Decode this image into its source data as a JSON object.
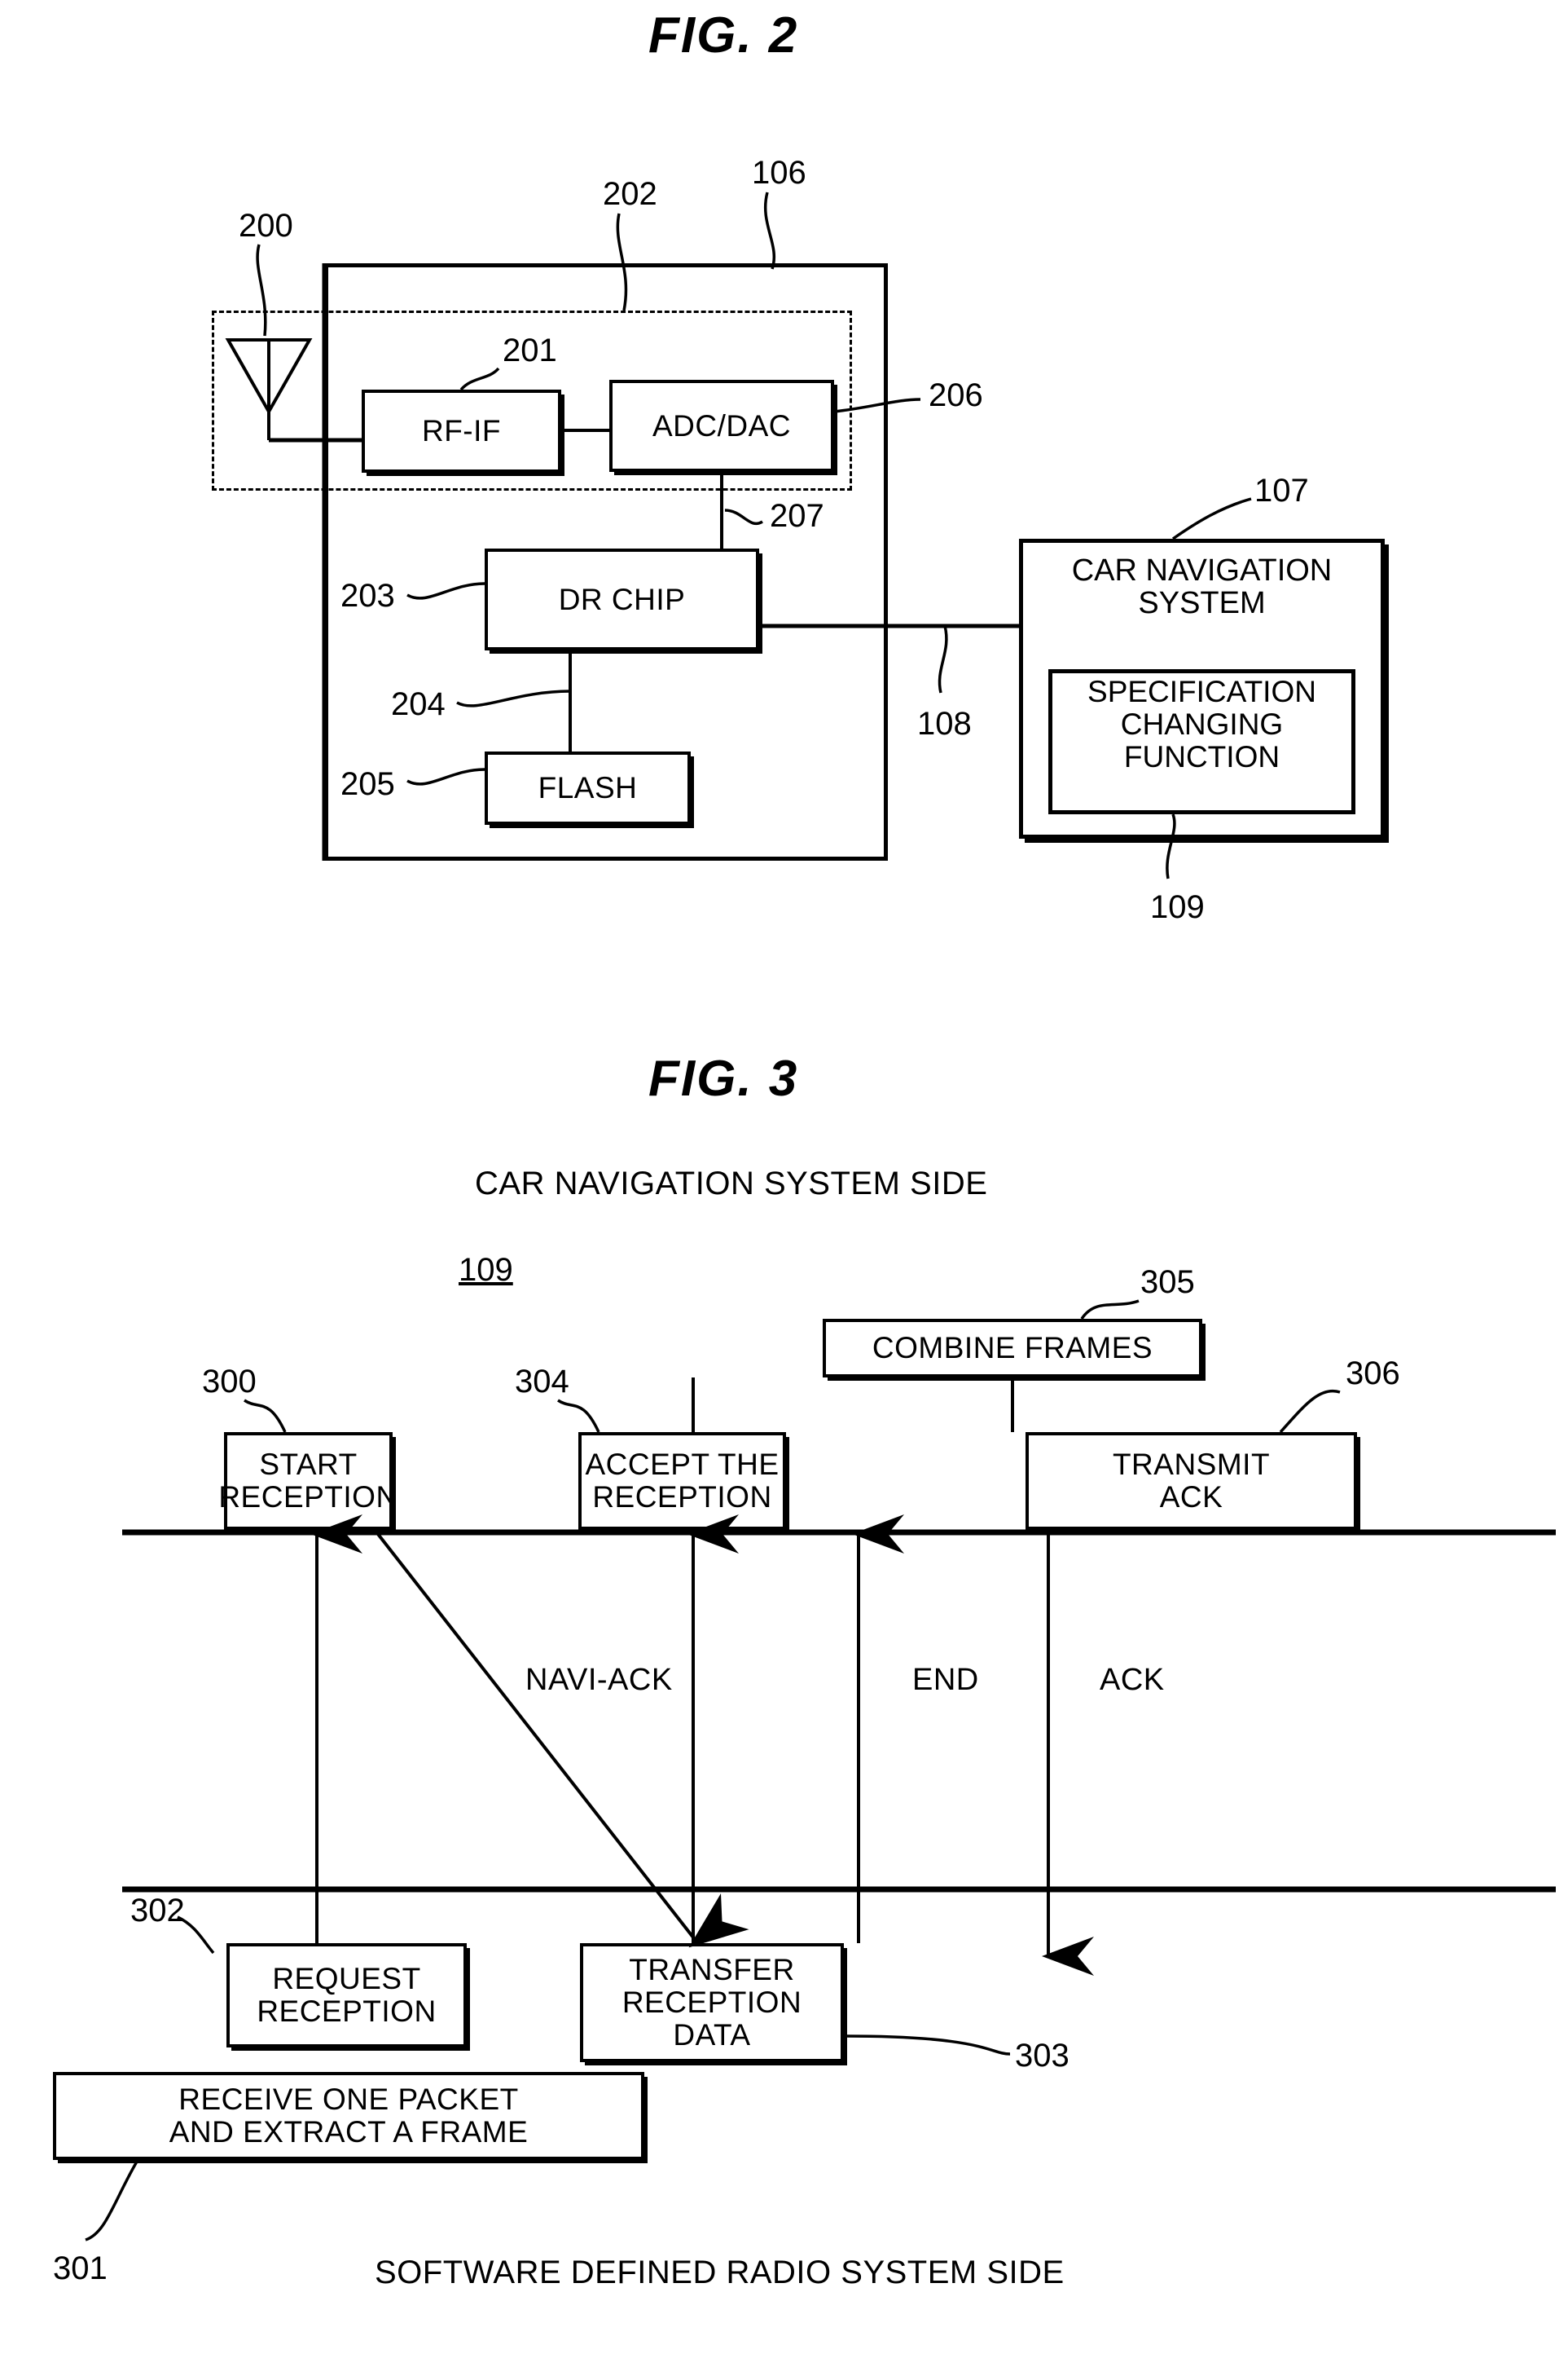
{
  "figures": [
    {
      "title": "FIG.  2",
      "refs": [
        "200",
        "202",
        "106",
        "201",
        "206",
        "207",
        "203",
        "204",
        "205",
        "107",
        "108",
        "109"
      ],
      "boxes": [
        {
          "id": "rf-if",
          "label": "RF-IF"
        },
        {
          "id": "adc-dac",
          "label": "ADC/DAC"
        },
        {
          "id": "dr-chip",
          "label": "DR CHIP"
        },
        {
          "id": "flash",
          "label": "FLASH"
        },
        {
          "id": "car-nav",
          "label": "CAR NAVIGATION\nSYSTEM"
        },
        {
          "id": "spec-change",
          "label": "SPECIFICATION\nCHANGING\nFUNCTION"
        }
      ]
    },
    {
      "title": "FIG.  3",
      "top_side_label": "CAR NAVIGATION SYSTEM SIDE",
      "bottom_side_label": "SOFTWARE DEFINED RADIO SYSTEM SIDE",
      "center_ref": "109",
      "refs": [
        "300",
        "304",
        "305",
        "306",
        "302",
        "303",
        "301"
      ],
      "boxes": [
        {
          "id": "start-reception",
          "label": "START\nRECEPTION"
        },
        {
          "id": "accept-the-reception",
          "label": "ACCEPT THE\nRECEPTION"
        },
        {
          "id": "combine-frames",
          "label": "COMBINE FRAMES"
        },
        {
          "id": "transmit-ack",
          "label": "TRANSMIT\nACK"
        },
        {
          "id": "request-reception",
          "label": "REQUEST\nRECEPTION"
        },
        {
          "id": "transfer-reception-data",
          "label": "TRANSFER\nRECEPTION\nDATA"
        },
        {
          "id": "receive-one-packet",
          "label": "RECEIVE ONE PACKET\nAND EXTRACT A FRAME"
        }
      ],
      "arrow_labels": [
        "NAVI-ACK",
        "END",
        "ACK"
      ]
    }
  ],
  "fig2": {
    "title": "FIG.  2",
    "ref_200": "200",
    "ref_202": "202",
    "ref_106": "106",
    "ref_201": "201",
    "ref_206": "206",
    "ref_207": "207",
    "ref_203": "203",
    "ref_204": "204",
    "ref_205": "205",
    "ref_107": "107",
    "ref_108": "108",
    "ref_109": "109",
    "rf_if": "RF-IF",
    "adc_dac": "ADC/DAC",
    "dr_chip": "DR CHIP",
    "flash": "FLASH",
    "car_nav_l1": "CAR NAVIGATION",
    "car_nav_l2": "SYSTEM",
    "spec_l1": "SPECIFICATION",
    "spec_l2": "CHANGING",
    "spec_l3": "FUNCTION"
  },
  "fig3": {
    "title": "FIG.  3",
    "top_side": "CAR NAVIGATION SYSTEM SIDE",
    "bottom_side": "SOFTWARE DEFINED RADIO SYSTEM SIDE",
    "center_ref": "109",
    "ref_300": "300",
    "ref_304": "304",
    "ref_305": "305",
    "ref_306": "306",
    "ref_302": "302",
    "ref_303": "303",
    "ref_301": "301",
    "start_l1": "START",
    "start_l2": "RECEPTION",
    "accept_l1": "ACCEPT THE",
    "accept_l2": "RECEPTION",
    "combine": "COMBINE FRAMES",
    "transmit_l1": "TRANSMIT",
    "transmit_l2": "ACK",
    "request_l1": "REQUEST",
    "request_l2": "RECEPTION",
    "transfer_l1": "TRANSFER",
    "transfer_l2": "RECEPTION",
    "transfer_l3": "DATA",
    "receive_l1": "RECEIVE ONE PACKET",
    "receive_l2": "AND EXTRACT A FRAME",
    "label_navi_ack": "NAVI-ACK",
    "label_end": "END",
    "label_ack": "ACK"
  },
  "colors": {
    "ink": "#000000",
    "paper": "#ffffff"
  }
}
